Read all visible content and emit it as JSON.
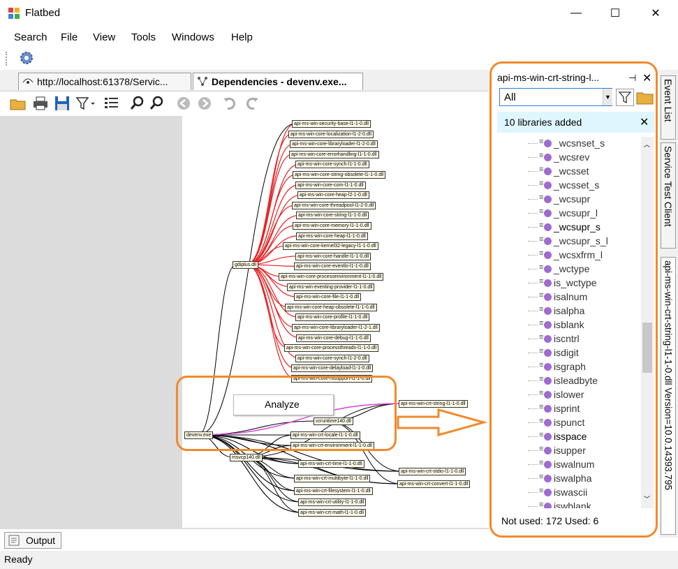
{
  "window": {
    "title": "Flatbed",
    "minimize": "—",
    "maximize": "☐",
    "close": "✕"
  },
  "menu": [
    "Search",
    "File",
    "View",
    "Tools",
    "Windows",
    "Help"
  ],
  "tabs": [
    {
      "label": "http://localhost:61378/Servic...",
      "active": false
    },
    {
      "label": "Dependencies - devenv.exe...",
      "active": true
    }
  ],
  "graph": {
    "context_menu_item": "Analyze",
    "nodes": [
      "api-ms-win-security-base-l1-1-0.dll",
      "api-ms-win-core-localization-l1-2-0.dll",
      "api-ms-win-core-libraryloader-l1-2-0.dll",
      "api-ms-win-core-errorhandling-l1-1-0.dll",
      "api-ms-win-core-synch-l1-1-0.dll",
      "api-ms-win-core-string-obsolete-l1-1-0.dll",
      "api-ms-win-core-com-l1-1-0.dll",
      "api-ms-win-core-heap-l2-1-0.dll",
      "api-ms-win-core-threadpool-l1-2-0.dll",
      "api-ms-win-core-string-l1-1-0.dll",
      "api-ms-win-core-memory-l1-1-0.dll",
      "api-ms-win-core-heap-l1-1-0.dll",
      "api-ms-win-core-kernel32-legacy-l1-1-0.dll",
      "api-ms-win-core-handle-l1-1-0.dll",
      "api-ms-win-core-eventlo-l1-1-0.dll",
      "api-ms-win-core-processenvironment-l1-1-0.dll",
      "api-ms-win-eventing-provider-l1-1-0.dll",
      "api-ms-win-core-file-l1-1-0.dll",
      "api-ms-win-core-heap-obsolete-l1-1-0.dll",
      "api-ms-win-core-profile-l1-1-0.dll",
      "api-ms-win-core-libraryloader-l1-2-1.dll",
      "api-ms-win-core-debug-l1-1-0.dll",
      "api-ms-win-core-processthreads-l1-1-0.dll",
      "api-ms-win-core-synch-l1-2-0.dll",
      "api-ms-win-core-delayload-l1-1-0.dll",
      "api-ms-win-core-rtlsupport-l1-1-0.dll",
      "gdiplus.dll",
      "devenv.exe",
      "vcruntime140.dll",
      "api-ms-win-crt-locale-l1-1-0.dll",
      "api-ms-win-crt-environment-l1-1-0.dll",
      "msvcp140.dll",
      "api-ms-win-crt-time-l1-1-0.dll",
      "api-ms-win-crt-multibyte-l1-1-0.dll",
      "api-ms-win-crt-filesystem-l1-1-0.dll",
      "api-ms-win-crt-utility-l1-1-0.dll",
      "api-ms-win-crt-math-l1-1-0.dll",
      "api-ms-win-crt-string-l1-1-0.dll",
      "api-ms-win-crt-stdio-l1-1-0.dll",
      "api-ms-win-crt-convert-l1-1-0.dll"
    ]
  },
  "panel": {
    "title": "api-ms-win-crt-string-l...",
    "filter_value": "All",
    "notification": "10 libraries added",
    "items": [
      "_wcsnset_s",
      "_wcsrev",
      "_wcsset",
      "_wcsset_s",
      "_wcsupr",
      "_wcsupr_l",
      "_wcsupr_s",
      "_wcsupr_s_l",
      "_wcsxfrm_l",
      "_wctype",
      "is_wctype",
      "isalnum",
      "isalpha",
      "isblank",
      "iscntrl",
      "isdigit",
      "isgraph",
      "isleadbyte",
      "islower",
      "isprint",
      "ispunct",
      "isspace",
      "isupper",
      "iswalnum",
      "iswalpha",
      "iswascii",
      "iswblank"
    ],
    "used_items": [
      "_wcsupr_s",
      "isspace"
    ],
    "status": "Not used: 172 Used: 6"
  },
  "side_tabs": {
    "event_list": "Event List",
    "service_test": "Service Test Client",
    "library": "api-ms-win-crt-string-l1-1-0.dll Version=10.0.14393.795"
  },
  "bottom": {
    "output_tab": "Output",
    "status": "Ready"
  },
  "colors": {
    "accent": "#f08a2c",
    "red_edge": "#e82020",
    "pink_edge": "#e040e0"
  }
}
